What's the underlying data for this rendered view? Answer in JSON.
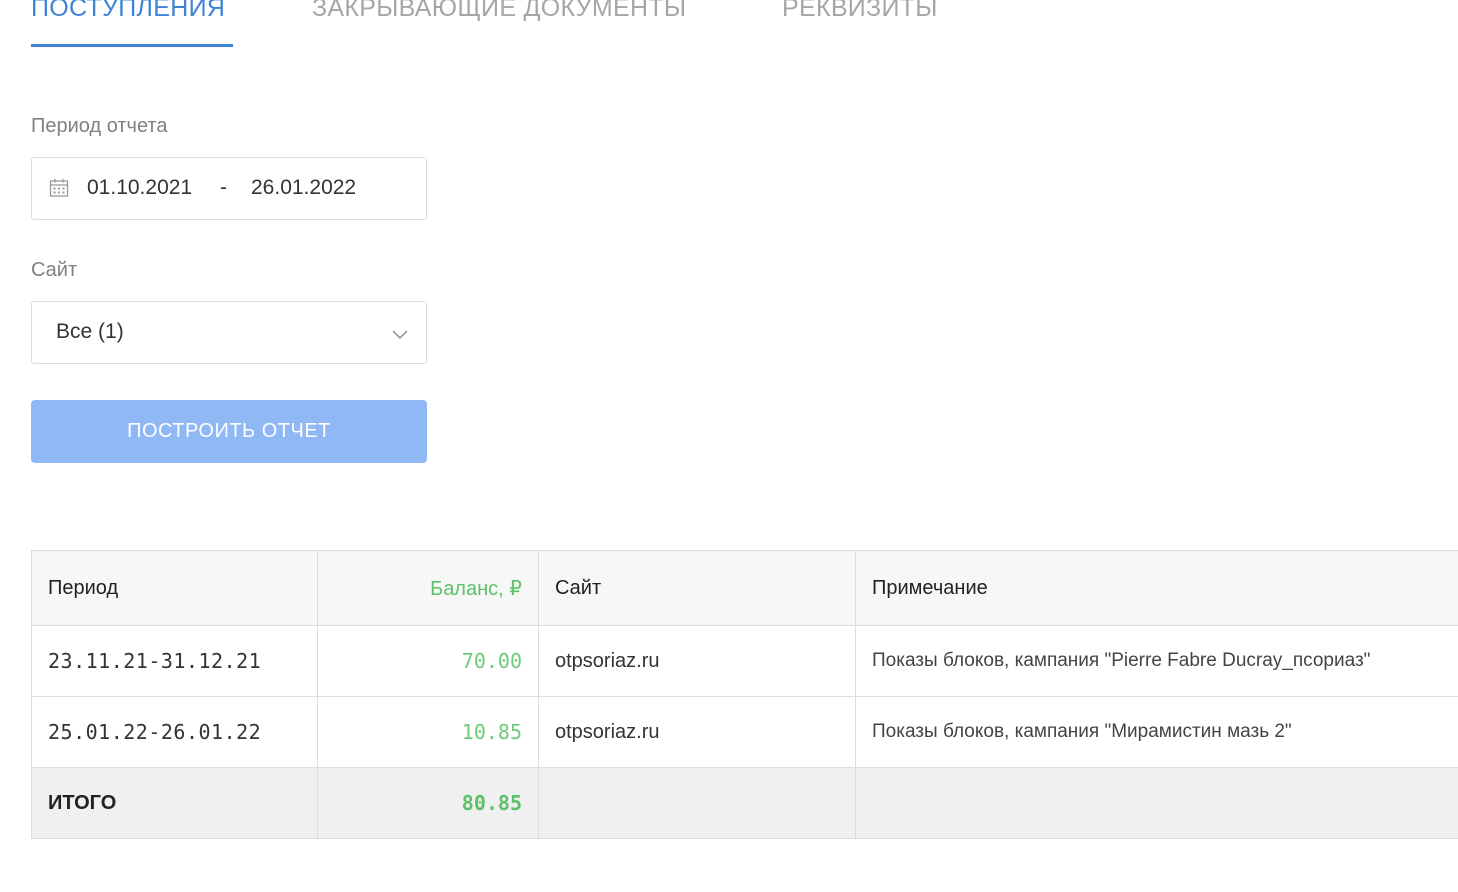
{
  "tabs": [
    {
      "label": "ПОСТУПЛЕНИЯ",
      "active": true
    },
    {
      "label": "ЗАКРЫВАЮЩИЕ ДОКУМЕНТЫ",
      "active": false
    },
    {
      "label": "РЕКВИЗИТЫ",
      "active": false
    }
  ],
  "filters": {
    "period_label": "Период отчета",
    "date_from": "01.10.2021",
    "date_separator": "-",
    "date_to": "26.01.2022",
    "site_label": "Сайт",
    "site_value": "Все (1)",
    "build_button": "ПОСТРОИТЬ ОТЧЕТ"
  },
  "table": {
    "headers": [
      "Период",
      "Баланс, ₽",
      "Сайт",
      "Примечание"
    ],
    "rows": [
      {
        "period": "23.11.21-31.12.21",
        "balance": "70.00",
        "site": "otpsoriaz.ru",
        "note": "Показы блоков, кампания \"Pierre Fabre Ducray_псориаз\""
      },
      {
        "period": "25.01.22-26.01.22",
        "balance": "10.85",
        "site": "otpsoriaz.ru",
        "note": "Показы блоков, кампания \"Мирамистин мазь 2\""
      }
    ],
    "total": {
      "label": "ИТОГО",
      "balance": "80.85"
    }
  },
  "colors": {
    "accent": "#3d84d6",
    "button": "#90b8f5",
    "positive": "#5cc26a"
  },
  "icons": {
    "date": "calendar-icon",
    "select": "chevron-down-icon"
  }
}
